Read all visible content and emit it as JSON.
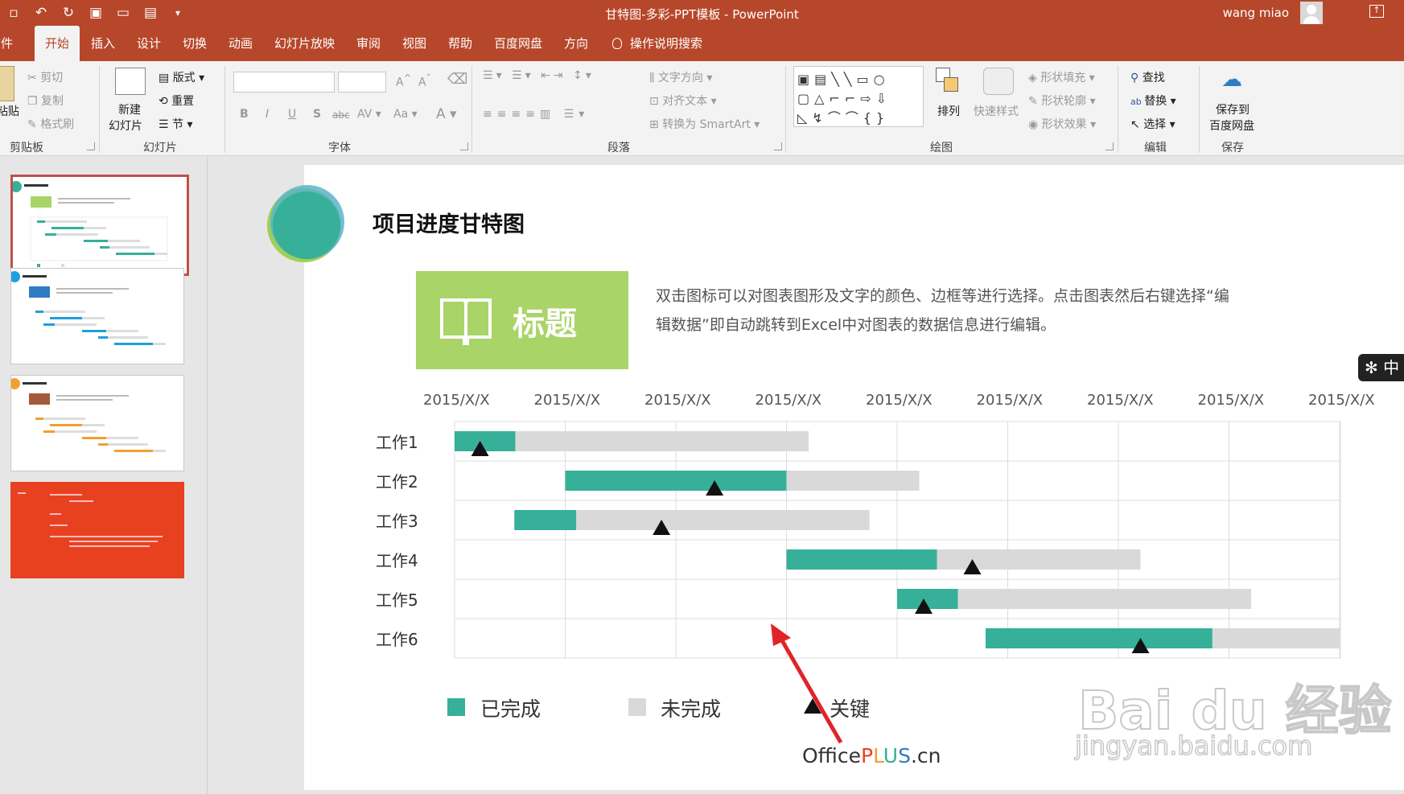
{
  "titlebar": {
    "document_title": "甘特图-多彩-PPT模板 - PowerPoint",
    "user_name": "wang miao",
    "qat_icons": [
      "save-icon",
      "undo-icon",
      "redo-icon",
      "slideshow-start-icon",
      "comment-icon",
      "layout-icon",
      "customize-icon"
    ],
    "bg_color": "#b7472a"
  },
  "tabs": [
    "文件",
    "开始",
    "插入",
    "设计",
    "切换",
    "动画",
    "幻灯片放映",
    "审阅",
    "视图",
    "帮助",
    "百度网盘",
    "方向",
    "操作说明搜索"
  ],
  "active_tab": "开始",
  "ribbon": {
    "clipboard": {
      "paste": "粘贴",
      "cut": "剪切",
      "copy": "复制",
      "format_painter": "格式刷",
      "label": "剪贴板"
    },
    "slides": {
      "new_slide_line1": "新建",
      "new_slide_line2": "幻灯片",
      "layout": "版式",
      "reset": "重置",
      "section": "节",
      "label": "幻灯片"
    },
    "font": {
      "bold": "B",
      "italic": "I",
      "underline": "U",
      "shadow": "S",
      "strike": "abc",
      "spacing": "AV",
      "case": "Aa",
      "color": "A",
      "grow": "A",
      "shrink": "A",
      "label": "字体"
    },
    "paragraph": {
      "text_direction": "文字方向",
      "align_text": "对齐文本",
      "smartart": "转换为 SmartArt",
      "label": "段落"
    },
    "drawing": {
      "arrange": "排列",
      "quick_styles": "快速样式",
      "shape_fill": "形状填充",
      "shape_outline": "形状轮廓",
      "shape_effects": "形状效果",
      "label": "绘图"
    },
    "editing": {
      "find": "查找",
      "replace": "替换",
      "select": "选择",
      "label": "编辑"
    },
    "save": {
      "line1": "保存到",
      "line2": "百度网盘",
      "label": "保存"
    }
  },
  "thumbnails": [
    {
      "accent": "#a9d468",
      "bar": "#36b099",
      "selected": true
    },
    {
      "accent": "#2f7cc4",
      "bar": "#1ea0dc",
      "selected": false
    },
    {
      "accent": "#a35a3b",
      "bar": "#f0a030",
      "selected": false
    },
    {
      "accent": "#e8411f",
      "bar": "#e8411f",
      "selected": false
    }
  ],
  "slide": {
    "title": "项目进度甘特图",
    "banner_text": "标题",
    "banner_icon": "open-book-icon",
    "description": "双击图标可以对图表图形及文字的颜色、边框等进行选择。点击图表然后右键选择“编辑数据”即自动跳转到Excel中对图表的数据信息进行编辑。",
    "watermark_prefix": "Office",
    "watermark_plus": "PLUS",
    "watermark_suffix": ".cn",
    "circle_colors": [
      "#9fcf5a",
      "#36b099",
      "#5ab4c8"
    ]
  },
  "chart_data": {
    "type": "bar",
    "orientation": "horizontal-gantt",
    "x_tick_labels": [
      "2015/X/X",
      "2015/X/X",
      "2015/X/X",
      "2015/X/X",
      "2015/X/X",
      "2015/X/X",
      "2015/X/X",
      "2015/X/X",
      "2015/X/X"
    ],
    "xlim": [
      0,
      8
    ],
    "categories": [
      "工作1",
      "工作2",
      "工作3",
      "工作4",
      "工作5",
      "工作6"
    ],
    "series": [
      {
        "name": "已完成",
        "color": "#36b099",
        "start": [
          0,
          1,
          0.54,
          3,
          4,
          4.8
        ],
        "end": [
          0.55,
          3,
          1.1,
          4.36,
          4.55,
          6.85
        ]
      },
      {
        "name": "未完成",
        "color": "#d9d9d9",
        "start": [
          0.55,
          3,
          1.1,
          4.36,
          4.55,
          6.85
        ],
        "end": [
          3.2,
          4.2,
          3.75,
          6.2,
          7.2,
          8
        ]
      }
    ],
    "key_markers": {
      "name": "关键",
      "x": [
        0.23,
        2.35,
        1.87,
        4.68,
        4.24,
        6.2
      ]
    },
    "grid": true
  },
  "baidu_watermark": {
    "text": "Bai du 经验",
    "url": "jingyan.baidu.com"
  },
  "ime": {
    "text": "中",
    "icon": "paw-icon"
  }
}
